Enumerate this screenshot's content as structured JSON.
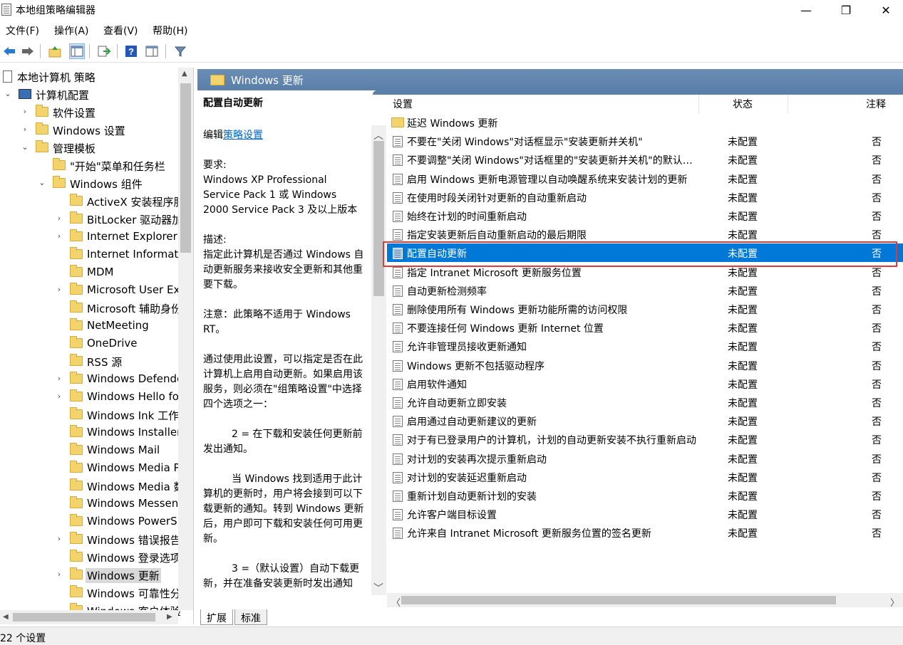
{
  "window": {
    "title": "本地组策略编辑器",
    "minimize": "—",
    "maximize": "❐",
    "close": "✕"
  },
  "menu": [
    "文件(F)",
    "操作(A)",
    "查看(V)",
    "帮助(H)"
  ],
  "tree": {
    "items": [
      {
        "label": "本地计算机 策略",
        "indent": 0,
        "exp": "",
        "icon": "policy"
      },
      {
        "label": "计算机配置",
        "indent": 1,
        "exp": "⌄",
        "icon": "computer"
      },
      {
        "label": "软件设置",
        "indent": 2,
        "exp": "›",
        "icon": "folder"
      },
      {
        "label": "Windows 设置",
        "indent": 2,
        "exp": "›",
        "icon": "folder"
      },
      {
        "label": "管理模板",
        "indent": 2,
        "exp": "⌄",
        "icon": "folder"
      },
      {
        "label": "\"开始\"菜单和任务栏",
        "indent": 3,
        "exp": "",
        "icon": "folder"
      },
      {
        "label": "Windows 组件",
        "indent": 3,
        "exp": "⌄",
        "icon": "folder"
      },
      {
        "label": "ActiveX 安装程序服",
        "indent": 4,
        "exp": "",
        "icon": "folder"
      },
      {
        "label": "BitLocker 驱动器加",
        "indent": 4,
        "exp": "›",
        "icon": "folder"
      },
      {
        "label": "Internet Explorer",
        "indent": 4,
        "exp": "›",
        "icon": "folder"
      },
      {
        "label": "Internet Informati",
        "indent": 4,
        "exp": "",
        "icon": "folder"
      },
      {
        "label": "MDM",
        "indent": 4,
        "exp": "",
        "icon": "folder"
      },
      {
        "label": "Microsoft User Ex",
        "indent": 4,
        "exp": "›",
        "icon": "folder"
      },
      {
        "label": "Microsoft 辅助身份",
        "indent": 4,
        "exp": "",
        "icon": "folder"
      },
      {
        "label": "NetMeeting",
        "indent": 4,
        "exp": "",
        "icon": "folder"
      },
      {
        "label": "OneDrive",
        "indent": 4,
        "exp": "",
        "icon": "folder"
      },
      {
        "label": "RSS 源",
        "indent": 4,
        "exp": "",
        "icon": "folder"
      },
      {
        "label": "Windows Defende",
        "indent": 4,
        "exp": "›",
        "icon": "folder"
      },
      {
        "label": "Windows Hello fo",
        "indent": 4,
        "exp": "›",
        "icon": "folder"
      },
      {
        "label": "Windows Ink 工作",
        "indent": 4,
        "exp": "",
        "icon": "folder"
      },
      {
        "label": "Windows Installer",
        "indent": 4,
        "exp": "",
        "icon": "folder"
      },
      {
        "label": "Windows Mail",
        "indent": 4,
        "exp": "",
        "icon": "folder"
      },
      {
        "label": "Windows Media P",
        "indent": 4,
        "exp": "",
        "icon": "folder"
      },
      {
        "label": "Windows Media 数",
        "indent": 4,
        "exp": "",
        "icon": "folder"
      },
      {
        "label": "Windows Messen",
        "indent": 4,
        "exp": "",
        "icon": "folder"
      },
      {
        "label": "Windows PowerS",
        "indent": 4,
        "exp": "",
        "icon": "folder"
      },
      {
        "label": "Windows 错误报告",
        "indent": 4,
        "exp": "›",
        "icon": "folder"
      },
      {
        "label": "Windows 登录选项",
        "indent": 4,
        "exp": "",
        "icon": "folder"
      },
      {
        "label": "Windows 更新",
        "indent": 4,
        "exp": "›",
        "icon": "folder",
        "selected": true
      },
      {
        "label": "Windows 可靠性分",
        "indent": 4,
        "exp": "",
        "icon": "folder"
      },
      {
        "label": "Windows 客户体验",
        "indent": 4,
        "exp": "",
        "icon": "folder"
      }
    ]
  },
  "right": {
    "header_title": "Windows 更新",
    "desc": {
      "title": "配置自动更新",
      "edit_prefix": "编辑",
      "edit_link": "策略设置",
      "req_label": "要求:",
      "req_text": "Windows XP Professional Service Pack 1 或 Windows 2000 Service Pack 3 及以上版本",
      "desc_label": "描述:",
      "desc_text": "指定此计算机是否通过 Windows 自动更新服务来接收安全更新和其他重要下载。",
      "note": "注意：此策略不适用于 Windows RT。",
      "p1": "通过使用此设置，可以指定是否在此计算机上启用自动更新。如果启用该服务，则必须在\"组策略设置\"中选择四个选项之一：",
      "p2": "2 = 在下载和安装任何更新前发出通知。",
      "p3": "当 Windows 找到适用于此计算机的更新时，用户将会接到可以下载更新的通知。转到 Windows 更新后，用户即可下载和安装任何可用更新。",
      "p4": "3 =（默认设置）自动下载更新，并在准备安装更新时发出通知"
    },
    "columns": {
      "setting": "设置",
      "state": "状态",
      "note": "注释"
    },
    "rows": [
      {
        "name": "延迟 Windows 更新",
        "state": "",
        "note": "",
        "folder": true
      },
      {
        "name": "不要在\"关闭 Windows\"对话框显示\"安装更新并关机\"",
        "state": "未配置",
        "note": "否"
      },
      {
        "name": "不要调整\"关闭 Windows\"对话框里的\"安装更新并关机\"的默认选项",
        "state": "未配置",
        "note": "否"
      },
      {
        "name": "启用 Windows 更新电源管理以自动唤醒系统来安装计划的更新",
        "state": "未配置",
        "note": "否"
      },
      {
        "name": "在使用时段关闭针对更新的自动重新启动",
        "state": "未配置",
        "note": "否"
      },
      {
        "name": "始终在计划的时间重新启动",
        "state": "未配置",
        "note": "否"
      },
      {
        "name": "指定安装更新后自动重新启动的最后期限",
        "state": "未配置",
        "note": "否"
      },
      {
        "name": "配置自动更新",
        "state": "未配置",
        "note": "否",
        "selected": true
      },
      {
        "name": "指定 Intranet Microsoft 更新服务位置",
        "state": "未配置",
        "note": "否"
      },
      {
        "name": "自动更新检测频率",
        "state": "未配置",
        "note": "否"
      },
      {
        "name": "删除使用所有 Windows 更新功能所需的访问权限",
        "state": "未配置",
        "note": "否"
      },
      {
        "name": "不要连接任何 Windows 更新 Internet 位置",
        "state": "未配置",
        "note": "否"
      },
      {
        "name": "允许非管理员接收更新通知",
        "state": "未配置",
        "note": "否"
      },
      {
        "name": "Windows 更新不包括驱动程序",
        "state": "未配置",
        "note": "否"
      },
      {
        "name": "启用软件通知",
        "state": "未配置",
        "note": "否"
      },
      {
        "name": "允许自动更新立即安装",
        "state": "未配置",
        "note": "否"
      },
      {
        "name": "启用通过自动更新建议的更新",
        "state": "未配置",
        "note": "否"
      },
      {
        "name": "对于有已登录用户的计算机，计划的自动更新安装不执行重新启动",
        "state": "未配置",
        "note": "否"
      },
      {
        "name": "对计划的安装再次提示重新启动",
        "state": "未配置",
        "note": "否"
      },
      {
        "name": "对计划的安装延迟重新启动",
        "state": "未配置",
        "note": "否"
      },
      {
        "name": "重新计划自动更新计划的安装",
        "state": "未配置",
        "note": "否"
      },
      {
        "name": "允许客户端目标设置",
        "state": "未配置",
        "note": "否"
      },
      {
        "name": "允许来自 Intranet Microsoft 更新服务位置的签名更新",
        "state": "未配置",
        "note": "否"
      }
    ]
  },
  "tabs": [
    "扩展",
    "标准"
  ],
  "status": "22 个设置"
}
